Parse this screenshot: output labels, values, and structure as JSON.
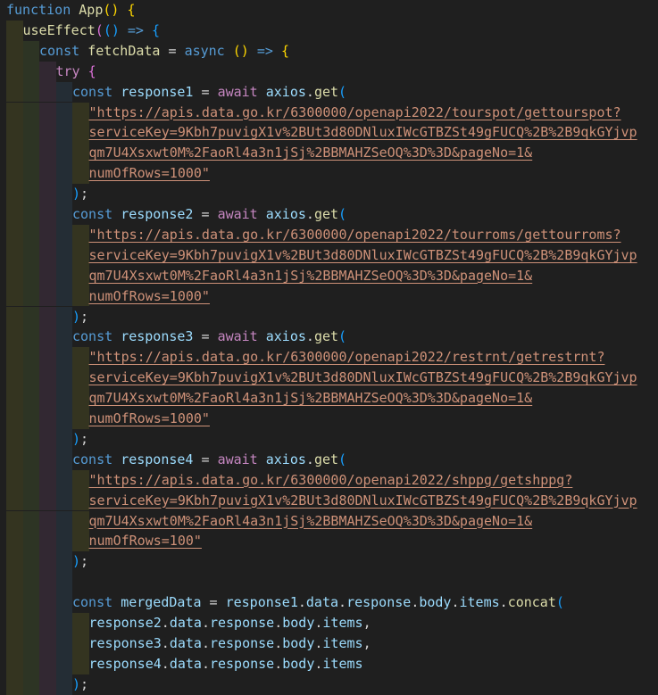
{
  "editor": {
    "language": "javascript",
    "colors": {
      "background": "#1f1f1f",
      "keyword": "#569cd6",
      "control": "#c586c0",
      "function": "#dcdcaa",
      "variable": "#9cdcfe",
      "string": "#ce9178",
      "bracket_level_1": "#ffd700",
      "bracket_level_2": "#da70d6",
      "bracket_level_3": "#179fff"
    },
    "lines": [
      {
        "indent": 0,
        "tokens": [
          [
            "kw",
            "function"
          ],
          [
            "plain",
            " "
          ],
          [
            "fn",
            "App"
          ],
          [
            "bk1",
            "()"
          ],
          [
            "plain",
            " "
          ],
          [
            "bk1",
            "{"
          ]
        ]
      },
      {
        "indent": 1,
        "tokens": [
          [
            "fn",
            "useEffect"
          ],
          [
            "bk2",
            "("
          ],
          [
            "bk3",
            "()"
          ],
          [
            "plain",
            " "
          ],
          [
            "kw",
            "=>"
          ],
          [
            "plain",
            " "
          ],
          [
            "bk3",
            "{"
          ]
        ]
      },
      {
        "indent": 2,
        "tokens": [
          [
            "kw",
            "const"
          ],
          [
            "plain",
            " "
          ],
          [
            "fn",
            "fetchData"
          ],
          [
            "plain",
            " = "
          ],
          [
            "kw",
            "async"
          ],
          [
            "plain",
            " "
          ],
          [
            "bk1",
            "()"
          ],
          [
            "plain",
            " "
          ],
          [
            "kw",
            "=>"
          ],
          [
            "plain",
            " "
          ],
          [
            "bk1",
            "{"
          ]
        ]
      },
      {
        "indent": 3,
        "tokens": [
          [
            "ctrl",
            "try"
          ],
          [
            "plain",
            " "
          ],
          [
            "bk2",
            "{"
          ]
        ]
      },
      {
        "indent": 4,
        "tokens": [
          [
            "kw",
            "const"
          ],
          [
            "plain",
            " "
          ],
          [
            "var",
            "response1"
          ],
          [
            "plain",
            " = "
          ],
          [
            "ctrl",
            "await"
          ],
          [
            "plain",
            " "
          ],
          [
            "var",
            "axios"
          ],
          [
            "plain",
            "."
          ],
          [
            "fn",
            "get"
          ],
          [
            "bk3",
            "("
          ]
        ]
      },
      {
        "indent": 5,
        "tokens": [
          [
            "str",
            "\"https://apis.data.go.kr/6300000/openapi2022/tourspot/gettourspot?"
          ]
        ],
        "link": true
      },
      {
        "indent": 5,
        "tokens": [
          [
            "str",
            "serviceKey=9Kbh7puvigX1v%2BUt3d80DNluxIWcGTBZSt49gFUCQ%2B%2B9qkGYjvp"
          ]
        ],
        "link": true
      },
      {
        "indent": 5,
        "tokens": [
          [
            "str",
            "qm7U4Xsxwt0M%2FaoRl4a3n1jSj%2BBMAHZSeOQ%3D%3D&pageNo=1&"
          ]
        ],
        "link": true
      },
      {
        "indent": 5,
        "tokens": [
          [
            "str",
            "numOfRows=1000\""
          ]
        ],
        "link": true
      },
      {
        "indent": 4,
        "tokens": [
          [
            "bk3",
            ")"
          ],
          [
            "plain",
            ";"
          ]
        ]
      },
      {
        "indent": 4,
        "tokens": [
          [
            "kw",
            "const"
          ],
          [
            "plain",
            " "
          ],
          [
            "var",
            "response2"
          ],
          [
            "plain",
            " = "
          ],
          [
            "ctrl",
            "await"
          ],
          [
            "plain",
            " "
          ],
          [
            "var",
            "axios"
          ],
          [
            "plain",
            "."
          ],
          [
            "fn",
            "get"
          ],
          [
            "bk3",
            "("
          ]
        ]
      },
      {
        "indent": 5,
        "tokens": [
          [
            "str",
            "\"https://apis.data.go.kr/6300000/openapi2022/tourroms/gettourroms?"
          ]
        ],
        "link": true
      },
      {
        "indent": 5,
        "tokens": [
          [
            "str",
            "serviceKey=9Kbh7puvigX1v%2BUt3d80DNluxIWcGTBZSt49gFUCQ%2B%2B9qkGYjvp"
          ]
        ],
        "link": true
      },
      {
        "indent": 5,
        "tokens": [
          [
            "str",
            "qm7U4Xsxwt0M%2FaoRl4a3n1jSj%2BBMAHZSeOQ%3D%3D&pageNo=1&"
          ]
        ],
        "link": true
      },
      {
        "indent": 5,
        "tokens": [
          [
            "str",
            "numOfRows=1000\""
          ]
        ],
        "link": true
      },
      {
        "indent": 4,
        "tokens": [
          [
            "bk3",
            ")"
          ],
          [
            "plain",
            ";"
          ]
        ]
      },
      {
        "indent": 4,
        "tokens": [
          [
            "kw",
            "const"
          ],
          [
            "plain",
            " "
          ],
          [
            "var",
            "response3"
          ],
          [
            "plain",
            " = "
          ],
          [
            "ctrl",
            "await"
          ],
          [
            "plain",
            " "
          ],
          [
            "var",
            "axios"
          ],
          [
            "plain",
            "."
          ],
          [
            "fn",
            "get"
          ],
          [
            "bk3",
            "("
          ]
        ]
      },
      {
        "indent": 5,
        "tokens": [
          [
            "str",
            "\"https://apis.data.go.kr/6300000/openapi2022/restrnt/getrestrnt?"
          ]
        ],
        "link": true
      },
      {
        "indent": 5,
        "tokens": [
          [
            "str",
            "serviceKey=9Kbh7puvigX1v%2BUt3d80DNluxIWcGTBZSt49gFUCQ%2B%2B9qkGYjvp"
          ]
        ],
        "link": true
      },
      {
        "indent": 5,
        "tokens": [
          [
            "str",
            "qm7U4Xsxwt0M%2FaoRl4a3n1jSj%2BBMAHZSeOQ%3D%3D&pageNo=1&"
          ]
        ],
        "link": true
      },
      {
        "indent": 5,
        "tokens": [
          [
            "str",
            "numOfRows=1000\""
          ]
        ],
        "link": true
      },
      {
        "indent": 4,
        "tokens": [
          [
            "bk3",
            ")"
          ],
          [
            "plain",
            ";"
          ]
        ]
      },
      {
        "indent": 4,
        "tokens": [
          [
            "kw",
            "const"
          ],
          [
            "plain",
            " "
          ],
          [
            "var",
            "response4"
          ],
          [
            "plain",
            " = "
          ],
          [
            "ctrl",
            "await"
          ],
          [
            "plain",
            " "
          ],
          [
            "var",
            "axios"
          ],
          [
            "plain",
            "."
          ],
          [
            "fn",
            "get"
          ],
          [
            "bk3",
            "("
          ]
        ]
      },
      {
        "indent": 5,
        "tokens": [
          [
            "str",
            "\"https://apis.data.go.kr/6300000/openapi2022/shppg/getshppg?"
          ]
        ],
        "link": true
      },
      {
        "indent": 5,
        "tokens": [
          [
            "str",
            "serviceKey=9Kbh7puvigX1v%2BUt3d80DNluxIWcGTBZSt49gFUCQ%2B%2B9qkGYjvp"
          ]
        ],
        "link": true
      },
      {
        "indent": 5,
        "tokens": [
          [
            "str",
            "qm7U4Xsxwt0M%2FaoRl4a3n1jSj%2BBMAHZSeOQ%3D%3D&pageNo=1&"
          ]
        ],
        "link": true
      },
      {
        "indent": 5,
        "tokens": [
          [
            "str",
            "numOfRows=100\""
          ]
        ],
        "link": true
      },
      {
        "indent": 4,
        "tokens": [
          [
            "bk3",
            ")"
          ],
          [
            "plain",
            ";"
          ]
        ]
      },
      {
        "indent": 4,
        "tokens": []
      },
      {
        "indent": 4,
        "tokens": [
          [
            "kw",
            "const"
          ],
          [
            "plain",
            " "
          ],
          [
            "var",
            "mergedData"
          ],
          [
            "plain",
            " = "
          ],
          [
            "var",
            "response1"
          ],
          [
            "plain",
            "."
          ],
          [
            "var",
            "data"
          ],
          [
            "plain",
            "."
          ],
          [
            "var",
            "response"
          ],
          [
            "plain",
            "."
          ],
          [
            "var",
            "body"
          ],
          [
            "plain",
            "."
          ],
          [
            "var",
            "items"
          ],
          [
            "plain",
            "."
          ],
          [
            "fn",
            "concat"
          ],
          [
            "bk3",
            "("
          ]
        ]
      },
      {
        "indent": 5,
        "tokens": [
          [
            "var",
            "response2"
          ],
          [
            "plain",
            "."
          ],
          [
            "var",
            "data"
          ],
          [
            "plain",
            "."
          ],
          [
            "var",
            "response"
          ],
          [
            "plain",
            "."
          ],
          [
            "var",
            "body"
          ],
          [
            "plain",
            "."
          ],
          [
            "var",
            "items"
          ],
          [
            "plain",
            ","
          ]
        ]
      },
      {
        "indent": 5,
        "tokens": [
          [
            "var",
            "response3"
          ],
          [
            "plain",
            "."
          ],
          [
            "var",
            "data"
          ],
          [
            "plain",
            "."
          ],
          [
            "var",
            "response"
          ],
          [
            "plain",
            "."
          ],
          [
            "var",
            "body"
          ],
          [
            "plain",
            "."
          ],
          [
            "var",
            "items"
          ],
          [
            "plain",
            ","
          ]
        ]
      },
      {
        "indent": 5,
        "tokens": [
          [
            "var",
            "response4"
          ],
          [
            "plain",
            "."
          ],
          [
            "var",
            "data"
          ],
          [
            "plain",
            "."
          ],
          [
            "var",
            "response"
          ],
          [
            "plain",
            "."
          ],
          [
            "var",
            "body"
          ],
          [
            "plain",
            "."
          ],
          [
            "var",
            "items"
          ]
        ]
      },
      {
        "indent": 4,
        "tokens": [
          [
            "bk3",
            ")"
          ],
          [
            "plain",
            ";"
          ]
        ]
      }
    ]
  }
}
